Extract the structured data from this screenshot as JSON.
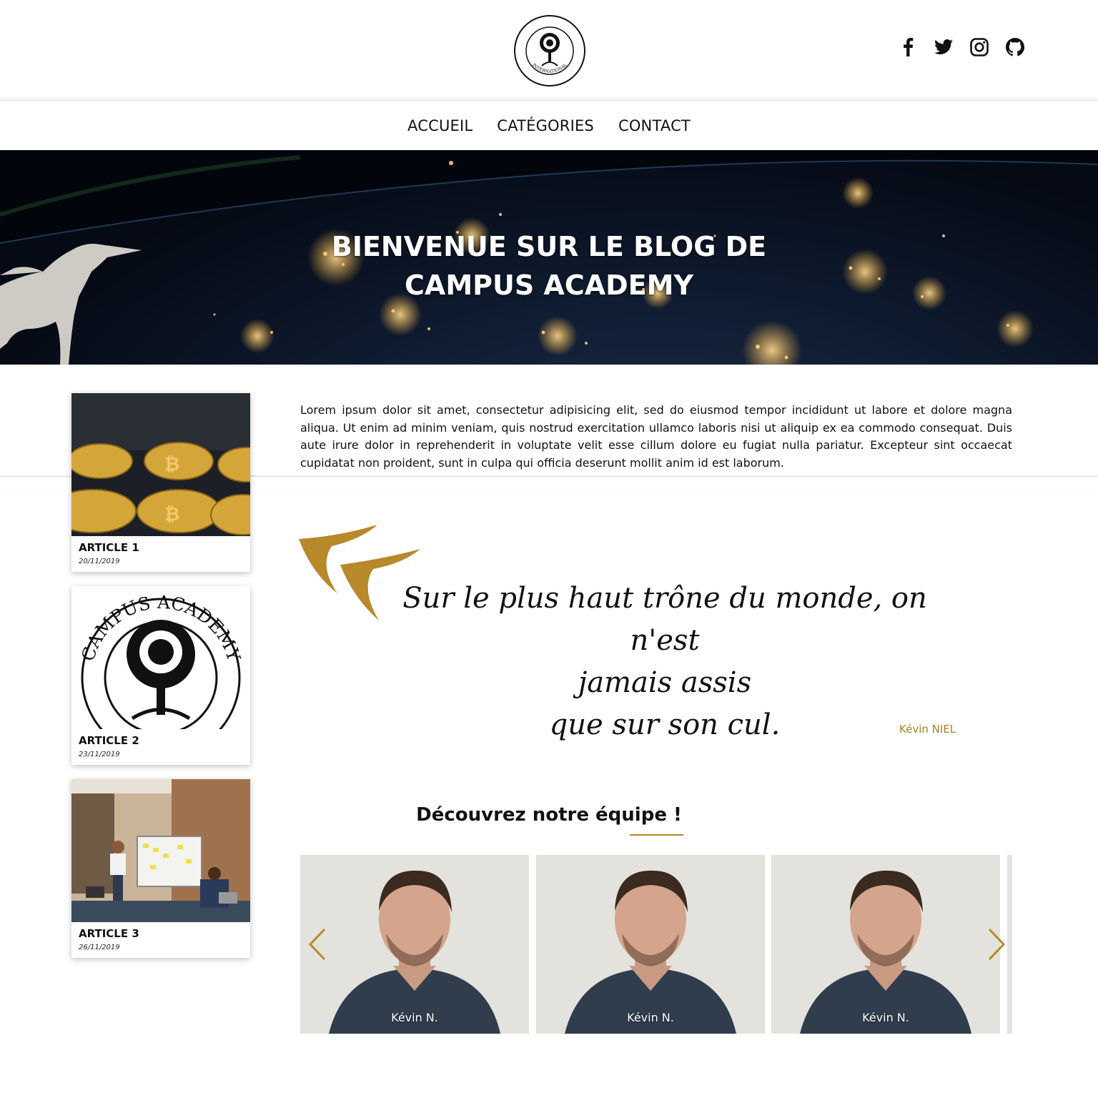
{
  "header": {
    "logo": {
      "label": "Campus Academy International logo",
      "top_text": "CAMPUS ACADEMY",
      "bottom_text": "INTERNATIONAL"
    },
    "social": [
      {
        "icon": "facebook-icon"
      },
      {
        "icon": "twitter-icon"
      },
      {
        "icon": "instagram-icon"
      },
      {
        "icon": "github-icon"
      }
    ]
  },
  "nav": {
    "items": [
      {
        "label": "ACCUEIL"
      },
      {
        "label": "CATÉGORIES"
      },
      {
        "label": "CONTACT"
      }
    ]
  },
  "hero": {
    "title_line1": "BIENVENUE SUR LE BLOG DE",
    "title_line2": "CAMPUS ACADEMY"
  },
  "articles": [
    {
      "title": "ARTICLE 1",
      "date": "20/11/2019",
      "image": "bitcoin-coins"
    },
    {
      "title": "ARTICLE 2",
      "date": "23/11/2019",
      "image": "campus-academy-logo"
    },
    {
      "title": "ARTICLE 3",
      "date": "26/11/2019",
      "image": "office-meeting"
    }
  ],
  "intro": {
    "text": "Lorem ipsum dolor sit amet, consectetur adipisicing elit, sed do eiusmod tempor incididunt ut labore et dolore magna aliqua. Ut enim ad minim veniam, quis nostrud exercitation ullamco laboris nisi ut aliquip ex ea commodo consequat. Duis aute irure dolor in reprehenderit in voluptate velit esse cillum dolore eu fugiat nulla pariatur. Excepteur sint occaecat cupidatat non proident, sunt in culpa qui officia deserunt mollit anim id est laborum."
  },
  "quote": {
    "line1": "Sur le plus haut trône du monde, on n'est",
    "line2": "jamais assis",
    "line3": "que sur son cul.",
    "author": "Kévin NIEL"
  },
  "team": {
    "title": "Découvrez notre équipe !",
    "members": [
      {
        "name": "Kévin N."
      },
      {
        "name": "Kévin N."
      },
      {
        "name": "Kévin N."
      }
    ]
  },
  "colors": {
    "accent": "#b8892a",
    "author": "#a8801f",
    "text": "#111111"
  }
}
